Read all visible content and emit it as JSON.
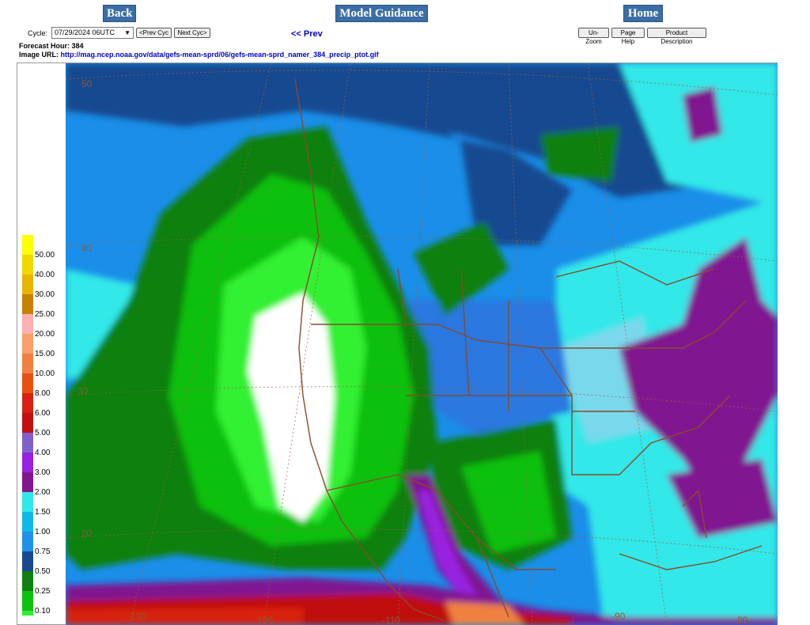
{
  "nav": {
    "back_label": "Back",
    "model_guidance_label": "Model Guidance",
    "home_label": "Home"
  },
  "controls": {
    "cycle_label": "Cycle:",
    "cycle_value": "07/29/2024 06UTC",
    "prev_cyc_label": "<Prev Cyc",
    "next_cyc_label": "Next Cyc>",
    "prev_link_label": "<< Prev",
    "unzoom_label": "Un-Zoom",
    "page_help_label": "Page Help",
    "product_description_label": "Product Description"
  },
  "info": {
    "forecast_hour_label": "Forecast Hour:",
    "forecast_hour_value": "384",
    "image_url_label": "Image URL:",
    "image_url_value": "http://mag.ncep.noaa.gov/data/gefs-mean-sprd/06/gefs-mean-sprd_namer_384_precip_ptot.gif"
  },
  "colorbar": {
    "labels": [
      "50.00",
      "40.00",
      "30.00",
      "25.00",
      "20.00",
      "15.00",
      "10.00",
      "8.00",
      "6.00",
      "5.00",
      "4.00",
      "3.00",
      "2.00",
      "1.50",
      "1.00",
      "0.75",
      "0.50",
      "0.25",
      "0.10"
    ],
    "colors": [
      "#ffff00",
      "#f0d800",
      "#e8b400",
      "#c88000",
      "#ffb0b0",
      "#f8a068",
      "#f08040",
      "#e85010",
      "#d82010",
      "#c01010",
      "#8060c8",
      "#9820e0",
      "#801890",
      "#30e8e8",
      "#10b8e8",
      "#2090e8",
      "#184890",
      "#108010",
      "#10c010",
      "#30f030"
    ]
  },
  "map": {
    "lat_labels": [
      "50",
      "40",
      "30",
      "20"
    ],
    "lon_labels": [
      "-130",
      "-120",
      "-110",
      "-90",
      "-80"
    ]
  }
}
